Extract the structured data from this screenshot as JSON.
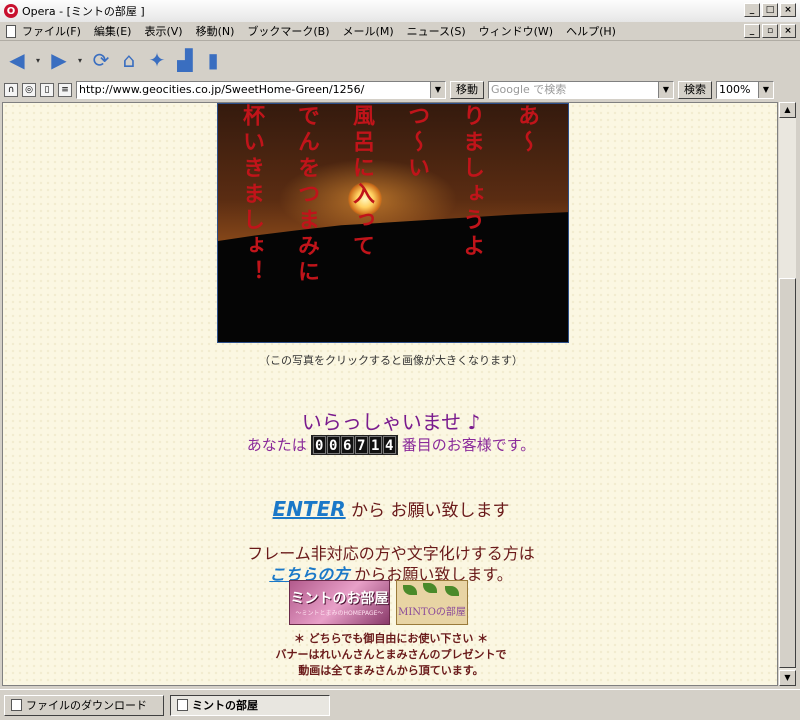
{
  "window": {
    "title": "Opera - [ミントの部屋 ]",
    "app_letter": "O"
  },
  "menu": [
    "ファイル(F)",
    "編集(E)",
    "表示(V)",
    "移動(N)",
    "ブックマーク(B)",
    "メール(M)",
    "ニュース(S)",
    "ウィンドウ(W)",
    "ヘルプ(H)"
  ],
  "toolbar": {
    "icons": [
      "back-icon",
      "forward-icon",
      "reload-icon",
      "home-icon",
      "wand-icon",
      "print-icon",
      "document-icon"
    ]
  },
  "address": {
    "url": "http://www.geocities.co.jp/SweetHome-Green/1256/",
    "go_label": "移動",
    "search_placeholder": "Google で検索",
    "search_label": "検索",
    "zoom": "100%"
  },
  "photo": {
    "columns": [
      "あ～",
      "りましょうよ",
      "つ～い",
      "風呂に入って",
      "でんをつまみに",
      "杯いきましょ！"
    ]
  },
  "page": {
    "caption": "（この写真をクリックすると画像が大きくなります）",
    "welcome": "いらっしゃいませ ♪",
    "visitor_prefix": "あなたは",
    "visitor_suffix": "番目のお客様です。",
    "counter_digits": [
      "0",
      "0",
      "6",
      "7",
      "1",
      "4"
    ],
    "enter_link": "ENTER",
    "enter_text": " から お願い致します",
    "frame_line1": "フレーム非対応の方や文字化けする方は",
    "frame_link": "こちらの方",
    "frame_line2_suffix": " からお願い致します。",
    "banner1_text": "ミントのお部屋",
    "banner1_sub": "〜ミントとまみのHOMEPAGE〜",
    "banner2_text": "MINTOの部屋",
    "note1": "＊ どちらでも御自由にお使い下さい ＊",
    "note2": "バナーはれいんさんとまみさんのプレゼントで",
    "note3": "動画は全てまみさんから頂ています。"
  },
  "status": {
    "downloads": "ファイルのダウンロード",
    "active_tab": "ミントの部屋"
  }
}
